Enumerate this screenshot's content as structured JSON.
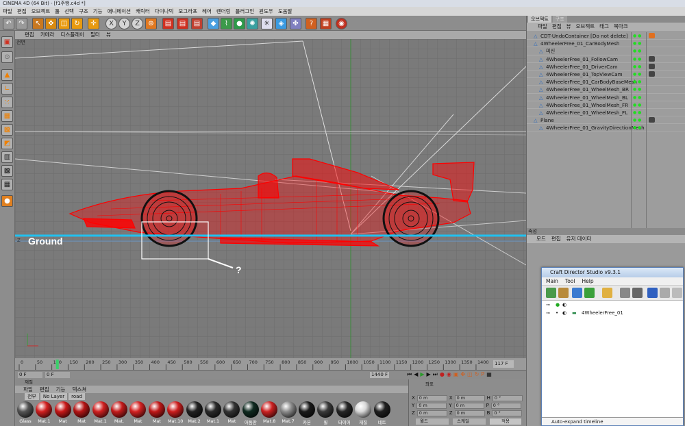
{
  "window": {
    "title": "CINEMA 4D (64 Bit) - [f1주행.c4d *]"
  },
  "menu": [
    "파일",
    "편집",
    "오브젝트",
    "툴",
    "선택",
    "구조",
    "기능",
    "애니메이션",
    "캐릭터",
    "다이나믹",
    "모그라프",
    "헤어",
    "렌더링",
    "플러그인",
    "윈도우",
    "도움말"
  ],
  "viewport": {
    "menu": [
      "편집",
      "카메라",
      "디스플레이",
      "필터",
      "뷰"
    ],
    "label": "전면",
    "annotations": {
      "ground_label": "Ground",
      "question_mark": "?"
    },
    "axis_z": "Z",
    "ground_color": "#22c0ee",
    "wireframe_color": "#ff0000"
  },
  "timeline": {
    "ticks": [
      "0",
      "50",
      "100",
      "150",
      "200",
      "250",
      "300",
      "350",
      "400",
      "450",
      "500",
      "550",
      "600",
      "650",
      "700",
      "750",
      "800",
      "850",
      "900",
      "950",
      "1000",
      "1050",
      "1100",
      "1150",
      "1200",
      "1250",
      "1300",
      "1350",
      "1400"
    ],
    "current_frame": "117 F",
    "start": "0 F",
    "start_marker": "0 F",
    "end": "1440 F"
  },
  "materials": {
    "header": "재질",
    "menu": [
      "파일",
      "편집",
      "기능",
      "텍스쳐"
    ],
    "tabs": [
      "전부",
      "No Layer",
      "road"
    ],
    "items": [
      {
        "label": "Glass",
        "color": "#555555"
      },
      {
        "label": "Mat.1",
        "color": "#d22020"
      },
      {
        "label": "Mat",
        "color": "#c81818"
      },
      {
        "label": "Mat",
        "color": "#b51515"
      },
      {
        "label": "Mat.1",
        "color": "#d02020"
      },
      {
        "label": "Mat.",
        "color": "#c41c1c"
      },
      {
        "label": "Mat",
        "color": "#d42222"
      },
      {
        "label": "Mat",
        "color": "#c01818"
      },
      {
        "label": "Mat.10",
        "color": "#cc1e1e"
      },
      {
        "label": "Mat.2",
        "color": "#222222"
      },
      {
        "label": "Mat.1",
        "color": "#2a2a2a"
      },
      {
        "label": "Mat",
        "color": "#333333"
      },
      {
        "label": "어둠판",
        "color": "#0f2a20"
      },
      {
        "label": "Mat.8",
        "color": "#cc2222"
      },
      {
        "label": "Mat.7",
        "color": "#8c8c8c"
      },
      {
        "label": "카본",
        "color": "#1a1a1a"
      },
      {
        "label": "휠",
        "color": "#3a3a3a"
      },
      {
        "label": "타이어",
        "color": "#262626"
      },
      {
        "label": "재질",
        "color": "#d8d8d8"
      },
      {
        "label": "네트",
        "color": "#202020"
      }
    ]
  },
  "coordinates": {
    "header": "좌표",
    "rows": [
      {
        "a": "X",
        "av": "0 m",
        "b": "X",
        "bv": "0 m",
        "c": "H",
        "cv": "0 °"
      },
      {
        "a": "Y",
        "av": "0 m",
        "b": "Y",
        "bv": "0 m",
        "c": "P",
        "cv": "0 °"
      },
      {
        "a": "Z",
        "av": "0 m",
        "b": "Z",
        "bv": "0 m",
        "c": "B",
        "cv": "0 °"
      }
    ],
    "mode": "월드",
    "scale": "스케일",
    "apply": "적용"
  },
  "object_manager": {
    "tabs": [
      "오브젝트",
      "구조"
    ],
    "menu": [
      "파일",
      "편집",
      "뷰",
      "오브젝트",
      "태그",
      "북마크"
    ],
    "items": [
      {
        "name": "CDT-UndoContainer [Do not delete]",
        "indent": 0
      },
      {
        "name": "4WheelerFree_01_CarBodyMesh",
        "indent": 0
      },
      {
        "name": "미신",
        "indent": 1
      },
      {
        "name": "4WheelerFree_01_FollowCam",
        "indent": 1
      },
      {
        "name": "4WheelerFree_01_DriverCam",
        "indent": 1
      },
      {
        "name": "4WheelerFree_01_TopViewCam",
        "indent": 1
      },
      {
        "name": "4WheelerFree_01_CarBodyBaseMesh",
        "indent": 1
      },
      {
        "name": "4WheelerFree_01_WheelMesh_BR",
        "indent": 1
      },
      {
        "name": "4WheelerFree_01_WheelMesh_BL",
        "indent": 1
      },
      {
        "name": "4WheelerFree_01_WheelMesh_FR",
        "indent": 1
      },
      {
        "name": "4WheelerFree_01_WheelMesh_FL",
        "indent": 1
      },
      {
        "name": "Plane",
        "indent": 0
      },
      {
        "name": "4WheelerFree_01_GravityDirectionMesh",
        "indent": 1
      }
    ]
  },
  "attributes": {
    "header": "속성",
    "menu": [
      "모드",
      "편집",
      "유저 데이터"
    ]
  },
  "craft_director": {
    "title": "Craft Director Studio v9.3.1",
    "menu": [
      "Main",
      "Tool",
      "Help"
    ],
    "item": "4WheelerFree_01",
    "status": "Auto-expand timeline"
  }
}
